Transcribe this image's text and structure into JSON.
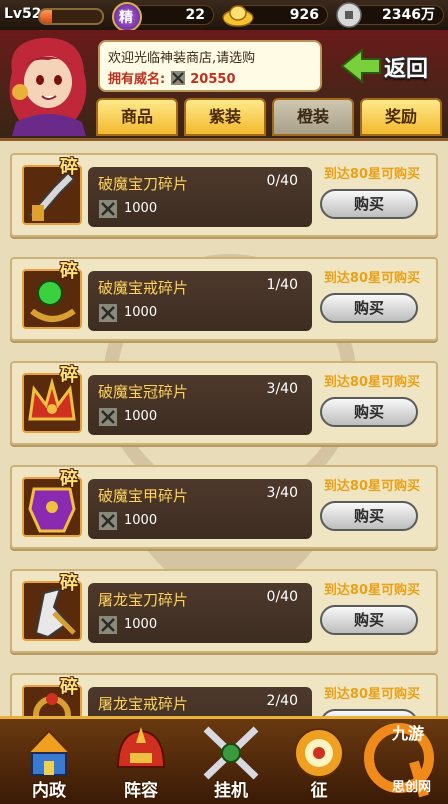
{
  "status_bar": {
    "level": "Lv52",
    "exp_fraction": 0.2,
    "jing_badge": "精",
    "jing_value": "22",
    "gold_value": "926",
    "coin_value": "2346万"
  },
  "header": {
    "greeting": "欢迎光临神装商店,请选购",
    "prestige_label": "拥有威名:",
    "prestige_value": "20550",
    "back_label": "返回"
  },
  "tabs": [
    {
      "label": "商品",
      "active": false
    },
    {
      "label": "紫装",
      "active": false
    },
    {
      "label": "橙装",
      "active": true
    },
    {
      "label": "奖励",
      "active": false
    }
  ],
  "items": [
    {
      "badge": "碎",
      "name": "破魔宝刀碎片",
      "progress": "0/40",
      "cost": "1000",
      "requirement": "到达80星可购买",
      "buy_label": "购买",
      "icon": "blade-icon"
    },
    {
      "badge": "碎",
      "name": "破魔宝戒碎片",
      "progress": "1/40",
      "cost": "1000",
      "requirement": "到达80星可购买",
      "buy_label": "购买",
      "icon": "ring-icon"
    },
    {
      "badge": "碎",
      "name": "破魔宝冠碎片",
      "progress": "3/40",
      "cost": "1000",
      "requirement": "到达80星可购买",
      "buy_label": "购买",
      "icon": "crown-icon"
    },
    {
      "badge": "碎",
      "name": "破魔宝甲碎片",
      "progress": "3/40",
      "cost": "1000",
      "requirement": "到达80星可购买",
      "buy_label": "购买",
      "icon": "armor-icon"
    },
    {
      "badge": "碎",
      "name": "屠龙宝刀碎片",
      "progress": "0/40",
      "cost": "1000",
      "requirement": "到达80星可购买",
      "buy_label": "购买",
      "icon": "dragon-blade-icon"
    },
    {
      "badge": "碎",
      "name": "屠龙宝戒碎片",
      "progress": "2/40",
      "cost": "1000",
      "requirement": "到达80星可购买",
      "buy_label": "购买",
      "icon": "dragon-ring-icon"
    }
  ],
  "bottom_nav": [
    {
      "label": "内政",
      "icon": "palace-icon"
    },
    {
      "label": "阵容",
      "icon": "helmet-icon"
    },
    {
      "label": "挂机",
      "icon": "crossed-swords-icon"
    },
    {
      "label": "征",
      "icon": "target-icon"
    }
  ],
  "watermark": {
    "brand": "九游",
    "sub": "思创网"
  }
}
